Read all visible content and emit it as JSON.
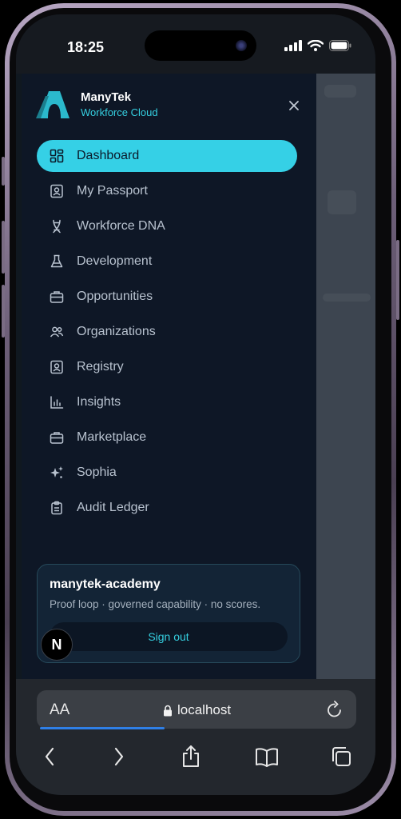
{
  "status_bar": {
    "time": "18:25"
  },
  "brand": {
    "name": "ManyTek",
    "subtitle": "Workforce Cloud"
  },
  "nav": {
    "items": [
      {
        "label": "Dashboard",
        "icon": "grid-icon",
        "active": true
      },
      {
        "label": "My Passport",
        "icon": "id-card-icon"
      },
      {
        "label": "Workforce DNA",
        "icon": "dna-icon"
      },
      {
        "label": "Development",
        "icon": "flask-icon"
      },
      {
        "label": "Opportunities",
        "icon": "briefcase-icon"
      },
      {
        "label": "Organizations",
        "icon": "users-icon"
      },
      {
        "label": "Registry",
        "icon": "id-card-icon"
      },
      {
        "label": "Insights",
        "icon": "bar-chart-icon"
      },
      {
        "label": "Marketplace",
        "icon": "briefcase-icon"
      },
      {
        "label": "Sophia",
        "icon": "sparkles-icon"
      },
      {
        "label": "Audit Ledger",
        "icon": "clipboard-icon"
      }
    ]
  },
  "account_card": {
    "title": "manytek-academy",
    "subtitle": "Proof loop · governed capability · no scores.",
    "sign_out_label": "Sign out",
    "avatar_letter": "N"
  },
  "browser": {
    "text_size_label": "AA",
    "url": "localhost",
    "load_progress": 0.4
  },
  "colors": {
    "accent": "#35d0e6",
    "drawer_bg": "#0e1726",
    "nav_text": "#b8c2cf"
  }
}
